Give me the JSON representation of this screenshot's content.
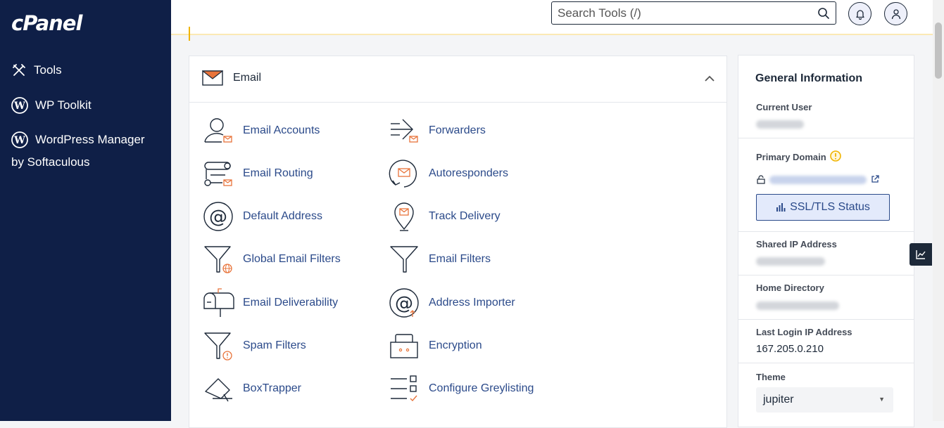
{
  "sidebar": {
    "logo": "cPanel",
    "items": [
      {
        "label": "Tools"
      },
      {
        "label": "WP Toolkit"
      },
      {
        "label": "WordPress Manager",
        "label_line2": "by Softaculous"
      }
    ]
  },
  "header": {
    "search_placeholder": "Search Tools (/)"
  },
  "email_section": {
    "title": "Email",
    "tools_col1": [
      {
        "label": "Email Accounts",
        "icon": "email-accounts-icon"
      },
      {
        "label": "Email Routing",
        "icon": "email-routing-icon"
      },
      {
        "label": "Default Address",
        "icon": "default-address-icon"
      },
      {
        "label": "Global Email Filters",
        "icon": "global-filter-icon"
      },
      {
        "label": "Email Deliverability",
        "icon": "mailbox-icon"
      },
      {
        "label": "Spam Filters",
        "icon": "spam-filter-icon"
      },
      {
        "label": "BoxTrapper",
        "icon": "boxtrapper-icon"
      }
    ],
    "tools_col2": [
      {
        "label": "Forwarders",
        "icon": "forwarders-icon"
      },
      {
        "label": "Autoresponders",
        "icon": "autoresponder-icon"
      },
      {
        "label": "Track Delivery",
        "icon": "track-delivery-icon"
      },
      {
        "label": "Email Filters",
        "icon": "filter-icon"
      },
      {
        "label": "Address Importer",
        "icon": "address-importer-icon"
      },
      {
        "label": "Encryption",
        "icon": "encryption-icon"
      },
      {
        "label": "Configure Greylisting",
        "icon": "greylisting-icon"
      }
    ]
  },
  "general_info": {
    "title": "General Information",
    "current_user_label": "Current User",
    "primary_domain_label": "Primary Domain",
    "ssl_button": "SSL/TLS Status",
    "shared_ip_label": "Shared IP Address",
    "home_dir_label": "Home Directory",
    "last_login_label": "Last Login IP Address",
    "last_login_value": "167.205.0.210",
    "theme_label": "Theme",
    "theme_value": "jupiter"
  },
  "colors": {
    "sidebar_bg": "#0f1f47",
    "accent_orange": "#e8743b",
    "link_blue": "#2b4a8a",
    "warning_yellow": "#f0b400"
  }
}
